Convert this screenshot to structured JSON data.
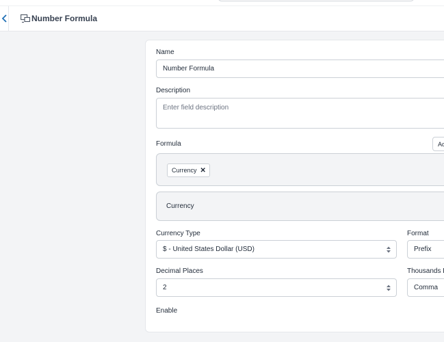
{
  "header": {
    "title": "Number Formula",
    "icon": "formula-field-icon"
  },
  "form": {
    "name": {
      "label": "Name",
      "value": "Number Formula"
    },
    "description": {
      "label": "Description",
      "placeholder": "Enter field description"
    },
    "formula": {
      "label": "Formula",
      "add_button_label": "Ad",
      "chip_label": "Currency",
      "chip_remove": "✕",
      "preview": "Currency"
    },
    "currency_type": {
      "label": "Currency Type",
      "value": "$ - United States Dollar (USD)"
    },
    "format": {
      "label": "Format",
      "value": "Prefix"
    },
    "decimal_places": {
      "label": "Decimal Places",
      "value": "2"
    },
    "thousands": {
      "label": "Thousands D",
      "value": "Comma"
    },
    "enable": {
      "label": "Enable"
    }
  }
}
